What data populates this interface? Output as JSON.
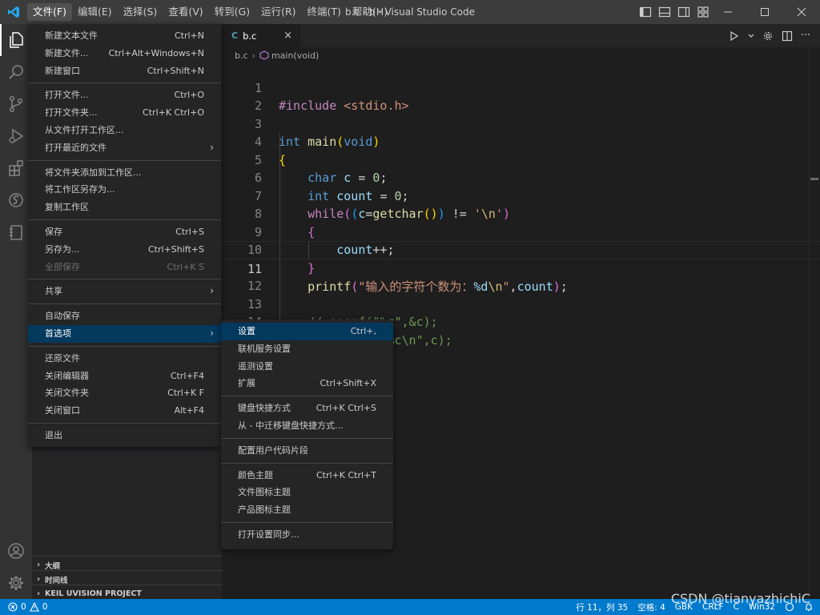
{
  "window": {
    "title": "b.c - b - Visual Studio Code",
    "menu": [
      "文件(F)",
      "编辑(E)",
      "选择(S)",
      "查看(V)",
      "转到(G)",
      "运行(R)",
      "终端(T)",
      "帮助(H)"
    ],
    "active_menu_index": 0
  },
  "colors": {
    "accent": "#007acc",
    "titlebar": "#3c3c3c",
    "activitybar": "#333333",
    "sidebar": "#252526",
    "editor": "#1e1e1e",
    "menu_selected": "#04395e"
  },
  "activity_icons": [
    "files-icon",
    "search-icon",
    "source-control-icon",
    "run-debug-icon",
    "extensions-icon",
    "keil-icon",
    "notebook-icon",
    "account-icon",
    "settings-gear-icon"
  ],
  "sidebar": {
    "sections": [
      "大纲",
      "时间线",
      "KEIL UVISION PROJECT"
    ]
  },
  "editor": {
    "tab": {
      "icon": "C",
      "name": "b.c"
    },
    "breadcrumb": [
      "b.c",
      "main(void)"
    ],
    "current_line": 11,
    "line_numbers": [
      "1",
      "2",
      "3",
      "4",
      "5",
      "6",
      "7",
      "8",
      "9",
      "10",
      "11",
      "12",
      "13",
      "14"
    ],
    "lines": [
      "#include <stdio.h>",
      "",
      "int main(void)",
      "{",
      "    char c = 0;",
      "    int count = 0;",
      "    while((c=getchar()) != '\\n')",
      "    {",
      "        count++;",
      "    }",
      "    printf(\"输入的字符个数为：%d\\n\",count);",
      "",
      "    // scanf(\"%c\",&c);",
      "    // printf(\"%c\\n\",c);"
    ]
  },
  "file_menu": {
    "groups": [
      [
        {
          "label": "新建文本文件",
          "shortcut": "Ctrl+N"
        },
        {
          "label": "新建文件...",
          "shortcut": "Ctrl+Alt+Windows+N"
        },
        {
          "label": "新建窗口",
          "shortcut": "Ctrl+Shift+N"
        }
      ],
      [
        {
          "label": "打开文件...",
          "shortcut": "Ctrl+O"
        },
        {
          "label": "打开文件夹...",
          "shortcut": "Ctrl+K Ctrl+O"
        },
        {
          "label": "从文件打开工作区...",
          "shortcut": ""
        },
        {
          "label": "打开最近的文件",
          "shortcut": "",
          "submenu": true
        }
      ],
      [
        {
          "label": "将文件夹添加到工作区...",
          "shortcut": ""
        },
        {
          "label": "将工作区另存为...",
          "shortcut": ""
        },
        {
          "label": "复制工作区",
          "shortcut": ""
        }
      ],
      [
        {
          "label": "保存",
          "shortcut": "Ctrl+S"
        },
        {
          "label": "另存为...",
          "shortcut": "Ctrl+Shift+S"
        },
        {
          "label": "全部保存",
          "shortcut": "Ctrl+K S",
          "disabled": true
        }
      ],
      [
        {
          "label": "共享",
          "shortcut": "",
          "submenu": true
        }
      ],
      [
        {
          "label": "自动保存",
          "shortcut": ""
        },
        {
          "label": "首选项",
          "shortcut": "",
          "submenu": true,
          "selected": true
        }
      ],
      [
        {
          "label": "还原文件",
          "shortcut": ""
        },
        {
          "label": "关闭编辑器",
          "shortcut": "Ctrl+F4"
        },
        {
          "label": "关闭文件夹",
          "shortcut": "Ctrl+K F"
        },
        {
          "label": "关闭窗口",
          "shortcut": "Alt+F4"
        }
      ],
      [
        {
          "label": "退出",
          "shortcut": ""
        }
      ]
    ]
  },
  "preferences_menu": {
    "groups": [
      [
        {
          "label": "设置",
          "shortcut": "Ctrl+,",
          "selected": true
        },
        {
          "label": "联机服务设置",
          "shortcut": ""
        },
        {
          "label": "遥测设置",
          "shortcut": ""
        },
        {
          "label": "扩展",
          "shortcut": "Ctrl+Shift+X"
        }
      ],
      [
        {
          "label": "键盘快捷方式",
          "shortcut": "Ctrl+K Ctrl+S"
        },
        {
          "label": "从 - 中迁移键盘快捷方式...",
          "shortcut": ""
        }
      ],
      [
        {
          "label": "配置用户代码片段",
          "shortcut": ""
        }
      ],
      [
        {
          "label": "颜色主题",
          "shortcut": "Ctrl+K Ctrl+T"
        },
        {
          "label": "文件图标主题",
          "shortcut": ""
        },
        {
          "label": "产品图标主题",
          "shortcut": ""
        }
      ],
      [
        {
          "label": "打开设置同步...",
          "shortcut": ""
        }
      ]
    ]
  },
  "statusbar": {
    "errors": "0",
    "warnings": "0",
    "position": "行 11，列 35",
    "spaces": "空格: 4",
    "encoding": "GBK",
    "eol": "CRLF",
    "language": "C",
    "platform": "Win32"
  },
  "watermark": "CSDN @tianyazhichiC"
}
